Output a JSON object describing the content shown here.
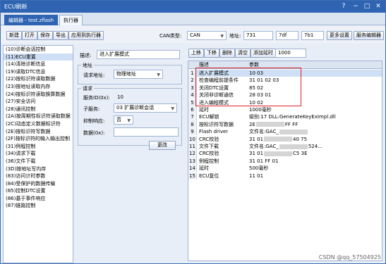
{
  "window": {
    "title": "ECU刷新",
    "help": "?",
    "minimize": "−",
    "maximize": "□",
    "close": "✕"
  },
  "tabs": [
    {
      "label": "编辑器 - test.zflash"
    },
    {
      "label": "执行器"
    }
  ],
  "toolbar": {
    "buttons": [
      "新建",
      "打开",
      "保存",
      "导出",
      "应用到执行器"
    ],
    "can_type_label": "CAN类型:",
    "can_type_value": "CAN",
    "address_label": "地址:",
    "addr1": "731",
    "addr2": "7df",
    "addr3": "7b1",
    "more_settings": "更多设置",
    "service_editor": "服务编辑器"
  },
  "services": [
    "(10)诊断会话控制",
    "(11)ECU重置",
    "(14)清除诊断信息",
    "(19)读取DTC信息",
    "(22)按标识符读取数据",
    "(23)按地址读取内存",
    "(24)按标识符读取换算数据",
    "(27)安全访问",
    "(28)通讯控制",
    "(2A)按周期性标识符读取数据",
    "(2C)动态定义数据标识符",
    "(2E)按标识符写数据",
    "(2F)按标识符的输入输出控制",
    "(31)例程控制",
    "(34)请求下载",
    "(36)文件下载",
    "(3D)按地址写内存",
    "(83)访问计时参数",
    "(84)受保护的数据传输",
    "(85)控制DTC设置",
    "(86)基于事件响应",
    "(87)链路控制"
  ],
  "selected_service_index": 1,
  "mid": {
    "desc_label": "描述:",
    "desc_value": "进入扩展模式",
    "address_group": "地址",
    "req_addr_label": "请求地址:",
    "req_addr_value": "物理地址",
    "request_group": "请求",
    "service_id_label": "服务ID(0x):",
    "service_id_value": "10",
    "subservice_label": "子服务:",
    "subservice_value": "03 扩展诊断会话",
    "suppress_label": "抑制响应:",
    "suppress_value": "否",
    "data_label": "数据(0x):",
    "data_value": "",
    "modify_button": "更改"
  },
  "right_toolbar": {
    "up": "上移",
    "down": "下移",
    "delete": "删除",
    "clear": "清空",
    "add_delay": "添加延时",
    "delay_value": "1000"
  },
  "grid": {
    "col_desc": "描述",
    "col_param": "参数",
    "rows": [
      {
        "num": "1",
        "desc": "进入扩展模式",
        "param": "10 03"
      },
      {
        "num": "2",
        "desc": "检查编程前提条件",
        "param": "31 01 02 03"
      },
      {
        "num": "3",
        "desc": "关闭DTC设置",
        "param": "85 02"
      },
      {
        "num": "4",
        "desc": "关闭非诊断通信",
        "param": "28 03 01"
      },
      {
        "num": "5",
        "desc": "进入编程模式",
        "param": "10 02"
      },
      {
        "num": "6",
        "desc": "延时",
        "param": "1000毫秒"
      },
      {
        "num": "7",
        "desc": "ECU解锁",
        "param": "级别:17 DLL:GenerateKeyExImpl.dll"
      },
      {
        "num": "8",
        "desc": "按标识符写数据",
        "param": "2E",
        "param_tail": "FF FF"
      },
      {
        "num": "9",
        "desc": "Flash driver",
        "param": "文件名:GAC_",
        "param_tail": ""
      },
      {
        "num": "10",
        "desc": "CRC校验",
        "param": "31 01",
        "param_tail": "40 75"
      },
      {
        "num": "11",
        "desc": "文件下载",
        "param": "文件名:GAC_",
        "param_tail": "524..."
      },
      {
        "num": "12",
        "desc": "CRC校验",
        "param": "31 01",
        "param_tail": "C5 3E"
      },
      {
        "num": "13",
        "desc": "例程控制",
        "param": "31 01 FF 01"
      },
      {
        "num": "14",
        "desc": "延时",
        "param": "500毫秒"
      },
      {
        "num": "15",
        "desc": "ECU复位",
        "param": "11 01"
      }
    ]
  },
  "watermark": "CSDN @qq_57504925",
  "colors": {
    "titlebar": "#2f64b3",
    "highlight": "#e02020",
    "selection": "#cfe0f6"
  }
}
